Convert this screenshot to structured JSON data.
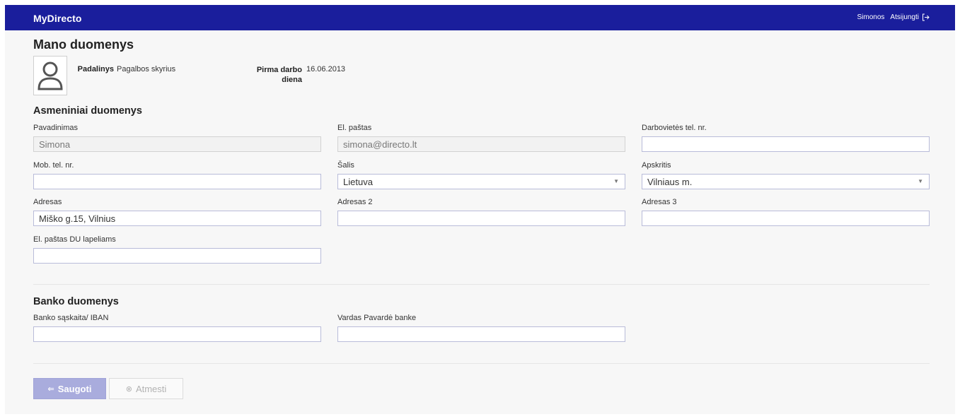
{
  "header": {
    "brand": "MyDirecto",
    "user": "Simonos",
    "logout_label": "Atsijungti"
  },
  "page": {
    "title": "Mano duomenys"
  },
  "profile": {
    "department_label": "Padalinys",
    "department_value": "Pagalbos skyrius",
    "first_day_label_1": "Pirma darbo",
    "first_day_label_2": "diena",
    "first_day_value": "16.06.2013"
  },
  "personal": {
    "title": "Asmeniniai duomenys",
    "name_label": "Pavadinimas",
    "name_value": "Simona",
    "email_label": "El. paštas",
    "email_value": "simona@directo.lt",
    "work_phone_label": "Darbovietės tel. nr.",
    "work_phone_value": "",
    "mobile_label": "Mob. tel. nr.",
    "mobile_value": "",
    "country_label": "Šalis",
    "country_value": "Lietuva",
    "county_label": "Apskritis",
    "county_value": "Vilniaus m.",
    "address_label": "Adresas",
    "address_value": "Miško g.15, Vilnius",
    "address2_label": "Adresas 2",
    "address2_value": "",
    "address3_label": "Adresas 3",
    "address3_value": "",
    "payslip_email_label": "El. paštas DU lapeliams",
    "payslip_email_value": ""
  },
  "bank": {
    "title": "Banko duomenys",
    "iban_label": "Banko sąskaita/ IBAN",
    "iban_value": "",
    "holder_label": "Vardas Pavardė banke",
    "holder_value": ""
  },
  "actions": {
    "save_label": "Saugoti",
    "cancel_label": "Atmesti"
  },
  "colors": {
    "header_bg": "#1a1e9c",
    "save_button": "#a9acdd"
  },
  "icons": {
    "logout": "logout-icon",
    "avatar": "user-avatar-icon",
    "select_caret": "caret-down-icon",
    "save": "save-icon",
    "cancel": "cancel-icon"
  }
}
